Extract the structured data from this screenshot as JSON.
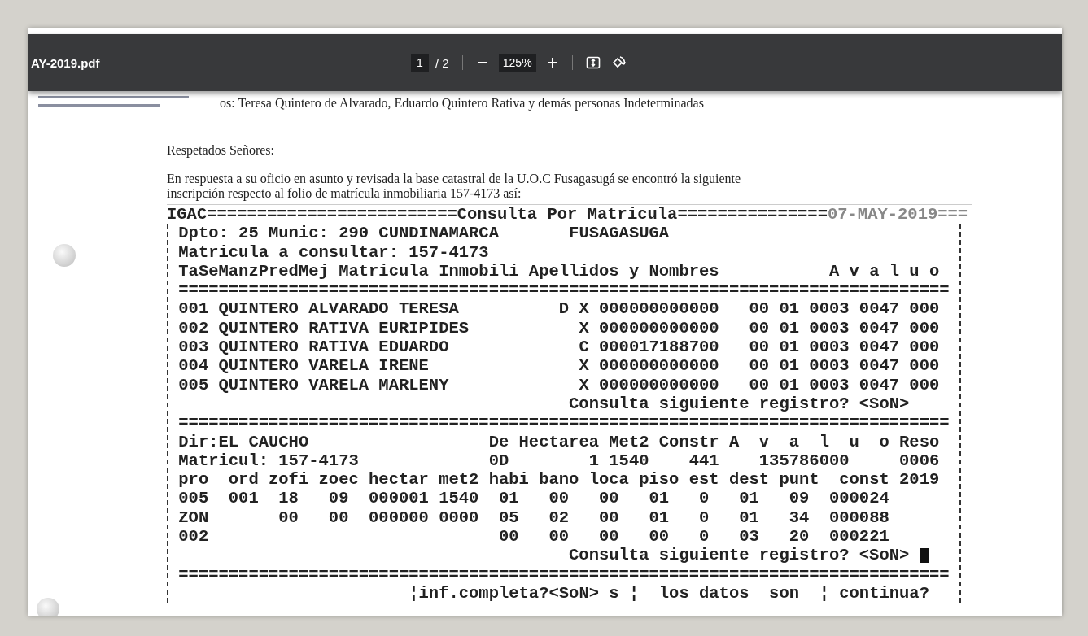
{
  "toolbar": {
    "filename": "AY-2019.pdf",
    "page": "1",
    "page_total": "/ 2",
    "zoom": "125%"
  },
  "document": {
    "recipient_line": "os: Teresa Quintero de Alvarado, Eduardo Quintero Rativa y demás personas Indeterminadas",
    "greeting": "Respetados Señores:",
    "paragraph_lines": [
      "En respuesta a su oficio en asunto  y revisada la base catastral de la U.O.C Fusagasugá se encontró la siguiente",
      "inscripción respecto al  folio de matrícula inmobiliaria 157-4173 así:"
    ],
    "terminal": {
      "header": "IGAC=========================Consulta Por Matricula===============",
      "date": "07-MAY-2019===",
      "lines": [
        {
          "kind": "text",
          "text": "Dpto: 25 Munic: 290 CUNDINAMARCA       FUSAGASUGA"
        },
        {
          "kind": "text",
          "text": "Matricula a consultar: 157-4173"
        },
        {
          "kind": "text",
          "text": "TaSeManzPredMej Matricula Inmobili Apellidos y Nombres           A v a l u o"
        },
        {
          "kind": "separator",
          "text": "============================================================================="
        },
        {
          "kind": "text",
          "text": "001 QUINTERO ALVARADO TERESA          D X 000000000000   00 01 0003 0047 000"
        },
        {
          "kind": "text",
          "text": "002 QUINTERO RATIVA EURIPIDES           X 000000000000   00 01 0003 0047 000"
        },
        {
          "kind": "text",
          "text": "003 QUINTERO RATIVA EDUARDO             C 000017188700   00 01 0003 0047 000"
        },
        {
          "kind": "text",
          "text": "004 QUINTERO VARELA IRENE               X 000000000000   00 01 0003 0047 000"
        },
        {
          "kind": "text",
          "text": "005 QUINTERO VARELA MARLENY             X 000000000000   00 01 0003 0047 000"
        },
        {
          "kind": "prompt",
          "text": "Consulta siguiente registro? <SoN>",
          "cursor": false
        },
        {
          "kind": "separator",
          "text": "============================================================================="
        },
        {
          "kind": "text",
          "text": "Dir:EL CAUCHO                  De Hectarea Met2 Constr A  v  a  l  u  o Reso"
        },
        {
          "kind": "text",
          "text": "Matricul: 157-4173             0D        1 1540    441    135786000     0006"
        },
        {
          "kind": "text",
          "text": "pro  ord zofi zoec hectar met2 habi bano loca piso est dest punt  const 2019"
        },
        {
          "kind": "text",
          "text": "005  001  18   09  000001 1540  01   00   00   01   0   01   09  000024"
        },
        {
          "kind": "text",
          "text": "ZON       00   00  000000 0000  05   02   00   01   0   01   34  000088"
        },
        {
          "kind": "text",
          "text": "002                             00   00   00   00   0   03   20  000221"
        },
        {
          "kind": "prompt",
          "text": "Consulta siguiente registro? <SoN>",
          "cursor": true
        },
        {
          "kind": "separator",
          "text": "============================================================================="
        },
        {
          "kind": "text",
          "text": "                       ¦inf.completa?<SoN> s ¦  los datos  son  ¦ continua?"
        }
      ]
    }
  }
}
